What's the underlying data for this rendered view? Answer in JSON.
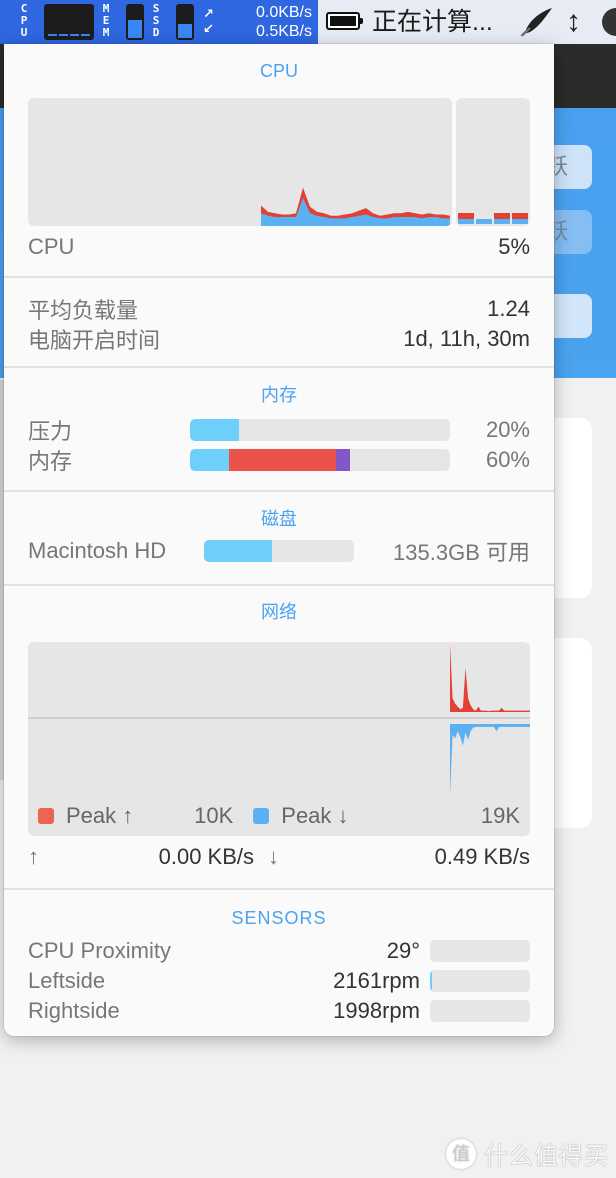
{
  "menubar": {
    "cpu_label": [
      "C",
      "P",
      "U"
    ],
    "mem_label": [
      "M",
      "E",
      "M"
    ],
    "ssd_label": [
      "S",
      "S",
      "D"
    ],
    "mem_gauge_fraction": 0.55,
    "ssd_gauge_fraction": 0.45,
    "net_arrows": [
      "↗",
      "↙"
    ],
    "upload_rate": "0.0KB/s",
    "download_rate": "0.5KB/s",
    "battery_status": "正在计算...",
    "icons": [
      "battery-icon",
      "feather-icon",
      "up-down-arrow-icon"
    ]
  },
  "background": {
    "buttons": [
      "跃",
      "跃",
      ""
    ],
    "watermark_logo": "值",
    "watermark_text": "什么值得买"
  },
  "cpu": {
    "title": "CPU",
    "label": "CPU",
    "value": "5%",
    "colors": {
      "system": "#e24134",
      "user": "#5ab0f0"
    },
    "history": {
      "user": [
        0.1,
        0.08,
        0.07,
        0.07,
        0.07,
        0.07,
        0.22,
        0.1,
        0.08,
        0.07,
        0.06,
        0.06,
        0.06,
        0.07,
        0.08,
        0.09,
        0.07,
        0.06,
        0.06,
        0.07,
        0.07,
        0.07,
        0.07,
        0.06,
        0.07,
        0.07,
        0.06,
        0.06
      ],
      "system": [
        0.06,
        0.03,
        0.03,
        0.02,
        0.02,
        0.03,
        0.08,
        0.05,
        0.03,
        0.03,
        0.02,
        0.02,
        0.03,
        0.03,
        0.04,
        0.05,
        0.03,
        0.02,
        0.03,
        0.03,
        0.03,
        0.04,
        0.03,
        0.03,
        0.03,
        0.02,
        0.03,
        0.02
      ]
    },
    "cores": [
      {
        "user": 0.04,
        "system": 0.05
      },
      {
        "user": 0.04,
        "system": 0.0
      },
      {
        "user": 0.04,
        "system": 0.05
      },
      {
        "user": 0.04,
        "system": 0.05
      }
    ]
  },
  "load": {
    "load_avg_label": "平均负载量",
    "load_avg_value": "1.24",
    "uptime_label": "电脑开启时间",
    "uptime_value": "1d, 11h, 30m"
  },
  "memory": {
    "title": "内存",
    "pressure_label": "压力",
    "pressure_value": "20%",
    "pressure_fraction": 0.19,
    "usage_label": "内存",
    "usage_value": "60%",
    "usage_segments": [
      {
        "name": "wired",
        "fraction": 0.15,
        "color": "#6ecffb"
      },
      {
        "name": "active",
        "fraction": 0.41,
        "color": "#ea524a"
      },
      {
        "name": "compressed",
        "fraction": 0.055,
        "color": "#8258c8"
      }
    ],
    "pressure_color": "#6ecffb"
  },
  "disk": {
    "title": "磁盘",
    "volume": "Macintosh HD",
    "free": "135.3GB 可用",
    "used_fraction": 0.45,
    "color": "#6ecffb"
  },
  "network": {
    "title": "网络",
    "peak_up_label": "Peak ↑",
    "peak_up_value": "10K",
    "peak_down_label": "Peak ↓",
    "peak_down_value": "19K",
    "up_color": "#e24134",
    "down_color": "#5ab0f0",
    "up_arrow": "↑",
    "up_rate": "0.00 KB/s",
    "down_arrow": "↓",
    "down_rate": "0.49 KB/s",
    "upload_history": [
      1.0,
      0.2,
      0.12,
      0.08,
      0.04,
      0.06,
      0.65,
      0.2,
      0.1,
      0.04,
      0.02,
      0.08,
      0.02,
      0.02,
      0.02,
      0.01,
      0.02,
      0.02,
      0.02,
      0.02,
      0.06,
      0.02,
      0.02,
      0.02,
      0.02,
      0.02,
      0.02,
      0.02,
      0.02,
      0.02,
      0.02,
      0.02
    ],
    "download_history": [
      1.0,
      0.15,
      0.2,
      0.1,
      0.18,
      0.3,
      0.12,
      0.22,
      0.1,
      0.05,
      0.04,
      0.04,
      0.04,
      0.04,
      0.04,
      0.04,
      0.04,
      0.04,
      0.1,
      0.04,
      0.04,
      0.04,
      0.04,
      0.04,
      0.04,
      0.04,
      0.04,
      0.04,
      0.04,
      0.04,
      0.04,
      0.04
    ]
  },
  "sensors": {
    "title": "SENSORS",
    "items": [
      {
        "label": "CPU Proximity",
        "value": "29°",
        "fraction": 0.0
      },
      {
        "label": "Leftside",
        "value": "2161rpm",
        "fraction": 0.02
      },
      {
        "label": "Rightside",
        "value": "1998rpm",
        "fraction": 0.0
      }
    ],
    "bar_color": "#6ecffb"
  }
}
